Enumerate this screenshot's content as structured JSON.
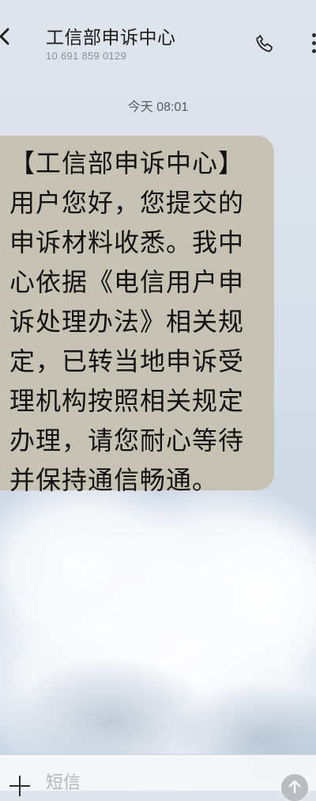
{
  "header": {
    "title": "工信部申诉中心",
    "sender_number": "10 691 859 0129",
    "icons": {
      "back": "chevron-left-icon",
      "call": "phone-icon",
      "more": "more-vertical-icon"
    }
  },
  "conversation": {
    "timestamp": "今天 08:01",
    "messages": [
      {
        "text": "【工信部申诉中心】用户您好，您提交的申诉材料收悉。我中心依据《电信用户申诉处理办法》相关规定，已转当地申诉受理机构按照相关规定办理，请您耐心等待并保持通信畅通。"
      }
    ]
  },
  "composer": {
    "placeholder": "短信",
    "icons": {
      "add": "plus-icon",
      "send": "send-arrow-icon"
    }
  },
  "colors": {
    "bubble": "#c6c3b5",
    "background": "#d7e0ea"
  }
}
